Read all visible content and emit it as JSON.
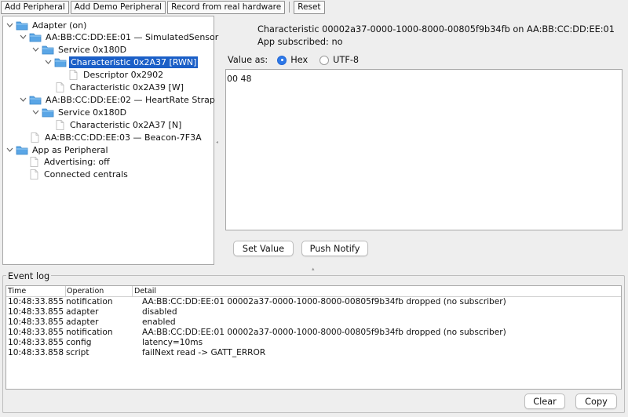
{
  "toolbar": {
    "add_peripheral": "Add Peripheral",
    "add_demo_peripheral": "Add Demo Peripheral",
    "record_real": "Record from real hardware",
    "reset": "Reset"
  },
  "tree": {
    "adapter": "Adapter (on)",
    "dev1": "AA:BB:CC:DD:EE:01 — SimulatedSensor",
    "dev1_service": "Service 0x180D",
    "dev1_char1": "Characteristic 0x2A37 [RWN]",
    "dev1_desc": "Descriptor 0x2902",
    "dev1_char2": "Characteristic 0x2A39 [W]",
    "dev2": "AA:BB:CC:DD:EE:02 — HeartRate Strap",
    "dev2_service": "Service 0x180D",
    "dev2_char": "Characteristic 0x2A37 [N]",
    "dev3": "AA:BB:CC:DD:EE:03 — Beacon-7F3A",
    "app_peripheral": "App as Peripheral",
    "advertising": "Advertising: off",
    "connected": "Connected centrals"
  },
  "detail": {
    "title": "Characteristic 00002a37-0000-1000-8000-00805f9b34fb on AA:BB:CC:DD:EE:01",
    "subscribed": "App subscribed: no",
    "value_as": "Value as:",
    "hex": "Hex",
    "utf8": "UTF-8",
    "value": "00 48",
    "set_value": "Set Value",
    "push_notify": "Push Notify"
  },
  "log": {
    "title": "Event log",
    "columns": {
      "time": "Time",
      "operation": "Operation",
      "detail": "Detail"
    },
    "rows": [
      {
        "time": "10:48:33.855",
        "op": "notification",
        "detail": "AA:BB:CC:DD:EE:01 00002a37-0000-1000-8000-00805f9b34fb dropped (no subscriber)"
      },
      {
        "time": "10:48:33.855",
        "op": "adapter",
        "detail": "disabled"
      },
      {
        "time": "10:48:33.855",
        "op": "adapter",
        "detail": "enabled"
      },
      {
        "time": "10:48:33.855",
        "op": "notification",
        "detail": "AA:BB:CC:DD:EE:01 00002a37-0000-1000-8000-00805f9b34fb dropped (no subscriber)"
      },
      {
        "time": "10:48:33.855",
        "op": "config",
        "detail": "latency=10ms"
      },
      {
        "time": "10:48:33.858",
        "op": "script",
        "detail": "failNext read -> GATT_ERROR"
      }
    ],
    "clear": "Clear",
    "copy": "Copy"
  },
  "colors": {
    "selection": "#1b5fc7",
    "folder": "#5aa6e6",
    "radio_on": "#2d78e8"
  },
  "icons": {
    "folder": "folder-icon",
    "leaf": "file-icon",
    "expand": "chevron-down-icon"
  }
}
